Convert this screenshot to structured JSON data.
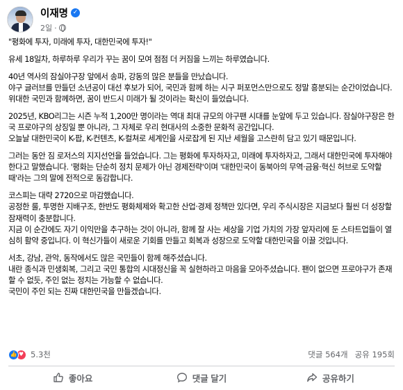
{
  "author": {
    "name": "이재명",
    "time": "2일",
    "separator": "·"
  },
  "post": {
    "paragraphs": [
      [
        "\"평화에 투자, 미래에 투자, 대한민국에 투자!\""
      ],
      [
        "유세 18일차, 하루하루 우리가 꾸는 꿈이 모여 점점 더 커짐을 느끼는 하루였습니다."
      ],
      [
        "40년 역사의 잠실야구장 앞에서 송파, 강동의 많은 분들을 만났습니다.",
        "야구 글러브를 만들던 소년공이 대선 후보가 되어, 국민과 함께 하는 시구 퍼포먼스만으로도 정말 흥분되는 순간이었습니다.",
        "위대한 국민과 함께하면, 꿈이 반드시 미래가 될 것이라는 확신이 들었습니다."
      ],
      [
        "2025년, KBO리그는 시즌 누적 1,200만 명이라는 역대 최대 규모의 야구팬 시대를 눈앞에 두고 있습니다. 잠실야구장은 한국 프로야구의 상징일 뿐 아니라, 그 자체로 우리 현대사의 소중한 문화적 공간입니다.",
        "오늘날 대한민국이 K-팝, K-컨텐츠, K-컬쳐로 세계인을 사로잡게 된 지난 세월을 고스란히 담고 있기 때문입니다."
      ],
      [
        "그러는 동안 짐 로저스의 지지선언을 들었습니다. 그는 평화에 투자하자고, 미래에 투자하자고, 그래서 대한민국에 투자해야 한다고 말했습니다. '평화는 단순히 정치 문제가 아닌 경제전략'이며 '대한민국이 동북아의 무역·금융·혁신 허브로 도약할 때'라는 그의 말에 전적으로 동감합니다."
      ],
      [
        "코스피는 대략 2720으로 마감했습니다.",
        "공정한 룰, 투명한 지배구조, 한반도 평화체제와 확고한 산업·경제 정책만 있다면, 우리 주식시장은 지금보다 훨씬 더 성장할 잠재력이 충분합니다.",
        "지금 이 순간에도 자기 이익만을 추구하는 것이 아니라, 함께 잘 사는 세상을 기업 가치의 가장 앞자리에 둔 스타트업들이 열심히 활약 중입니다. 이 혁신가들이 새로운 기회를 만들고 회복과 성장으로 도약할 대한민국을 이끌 것입니다."
      ],
      [
        "서초, 강남, 관악, 동작에서도 많은 국민들이 함께 해주셨습니다.",
        "내란 종식과 민생회복, 그리고 국민 통합의 시대정신을 꼭 실현하라고 마음을 모아주셨습니다. 팬이 없으면 프로야구가 존재할 수 없듯, 주인 없는 정치는 가능할 수 없습니다.",
        "국민이 주인 되는 진짜 대한민국을 만들겠습니다."
      ]
    ]
  },
  "stats": {
    "reactions": "5.3천",
    "comments": "댓글 564개",
    "shares": "공유 195회"
  },
  "actions": {
    "like": "좋아요",
    "comment": "댓글 달기",
    "share": "공유하기"
  },
  "colors": {
    "accent": "#1877f2",
    "love": "#f33e58",
    "muted": "#65676b"
  }
}
